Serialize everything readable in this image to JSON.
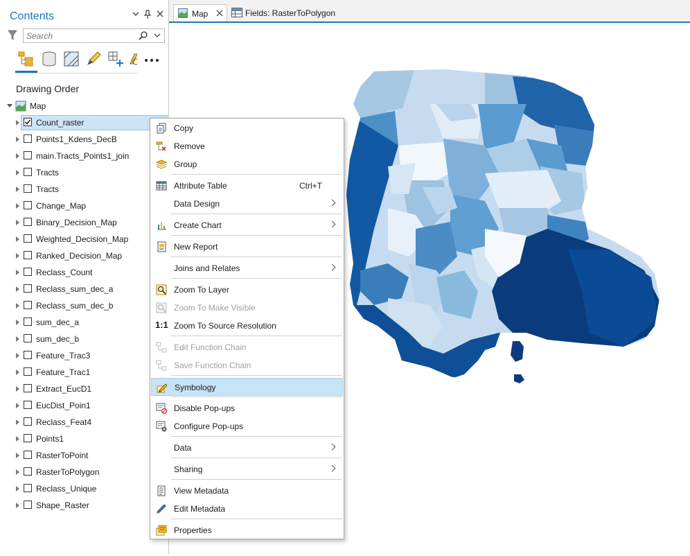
{
  "contents": {
    "title": "Contents",
    "search_placeholder": "Search",
    "heading": "Drawing Order",
    "map_label": "Map",
    "toolbar_icons": [
      "list-by-drawing-order-icon",
      "list-by-data-source-icon",
      "list-by-selection-icon",
      "list-by-editing-icon",
      "list-by-snapping-icon",
      "list-by-labeling-icon",
      "more-options-icon"
    ],
    "layers": [
      {
        "label": "Count_raster",
        "checked": true,
        "selected": true
      },
      {
        "label": "Points1_Kdens_DecB",
        "checked": false
      },
      {
        "label": "main.Tracts_Points1_join",
        "checked": false
      },
      {
        "label": "Tracts",
        "checked": false
      },
      {
        "label": "Tracts",
        "checked": false
      },
      {
        "label": "Change_Map",
        "checked": false
      },
      {
        "label": "Binary_Decision_Map",
        "checked": false
      },
      {
        "label": "Weighted_Decision_Map",
        "checked": false
      },
      {
        "label": "Ranked_Decision_Map",
        "checked": false
      },
      {
        "label": "Reclass_Count",
        "checked": false
      },
      {
        "label": "Reclass_sum_dec_a",
        "checked": false
      },
      {
        "label": "Reclass_sum_dec_b",
        "checked": false
      },
      {
        "label": "sum_dec_a",
        "checked": false
      },
      {
        "label": "sum_dec_b",
        "checked": false
      },
      {
        "label": "Feature_Trac3",
        "checked": false
      },
      {
        "label": "Feature_Trac1",
        "checked": false
      },
      {
        "label": "Extract_EucD1",
        "checked": false
      },
      {
        "label": "EucDist_Poin1",
        "checked": false
      },
      {
        "label": "Reclass_Feat4",
        "checked": false
      },
      {
        "label": "Points1",
        "checked": false
      },
      {
        "label": "RasterToPoint",
        "checked": false
      },
      {
        "label": "RasterToPolygon",
        "checked": false
      },
      {
        "label": "Reclass_Unique",
        "checked": false
      },
      {
        "label": "Shape_Raster",
        "checked": false
      }
    ]
  },
  "tabs": [
    {
      "label": "Map",
      "active": true
    },
    {
      "label": "Fields:  RasterToPolygon",
      "active": false
    }
  ],
  "context_menu": {
    "items": [
      {
        "label": "Copy",
        "icon": "copy-icon"
      },
      {
        "label": "Remove",
        "icon": "remove-icon"
      },
      {
        "label": "Group",
        "icon": "group-icon"
      },
      {
        "label": "Attribute Table",
        "icon": "table-icon",
        "shortcut": "Ctrl+T"
      },
      {
        "label": "Data Design",
        "submenu": true
      },
      {
        "label": "Create Chart",
        "icon": "chart-icon",
        "submenu": true
      },
      {
        "label": "New Report",
        "icon": "report-icon"
      },
      {
        "label": "Joins and Relates",
        "submenu": true
      },
      {
        "label": "Zoom To Layer",
        "icon": "zoom-to-layer-icon"
      },
      {
        "label": "Zoom To Make Visible",
        "icon": "zoom-visible-icon",
        "disabled": true
      },
      {
        "label": "Zoom To Source Resolution",
        "icon": "source-resolution-icon",
        "glyph": "1:1"
      },
      {
        "label": "Edit Function Chain",
        "icon": "function-chain-icon",
        "disabled": true
      },
      {
        "label": "Save Function Chain",
        "icon": "save-function-chain-icon",
        "disabled": true
      },
      {
        "label": "Symbology",
        "icon": "symbology-icon",
        "highlighted": true
      },
      {
        "label": "Disable Pop-ups",
        "icon": "disable-popups-icon"
      },
      {
        "label": "Configure Pop-ups",
        "icon": "configure-popups-icon"
      },
      {
        "label": "Data",
        "submenu": true
      },
      {
        "label": "Sharing",
        "submenu": true
      },
      {
        "label": "View Metadata",
        "icon": "view-metadata-icon"
      },
      {
        "label": "Edit Metadata",
        "icon": "edit-metadata-icon"
      },
      {
        "label": "Properties",
        "icon": "properties-icon"
      }
    ]
  },
  "colors": {
    "accent": "#1d76b8",
    "selection": "#cde4f7",
    "menu_highlight": "#c6e3f7",
    "map_light": "#d6e6f4",
    "map_mid": "#6baed6",
    "map_dark": "#08306b"
  }
}
